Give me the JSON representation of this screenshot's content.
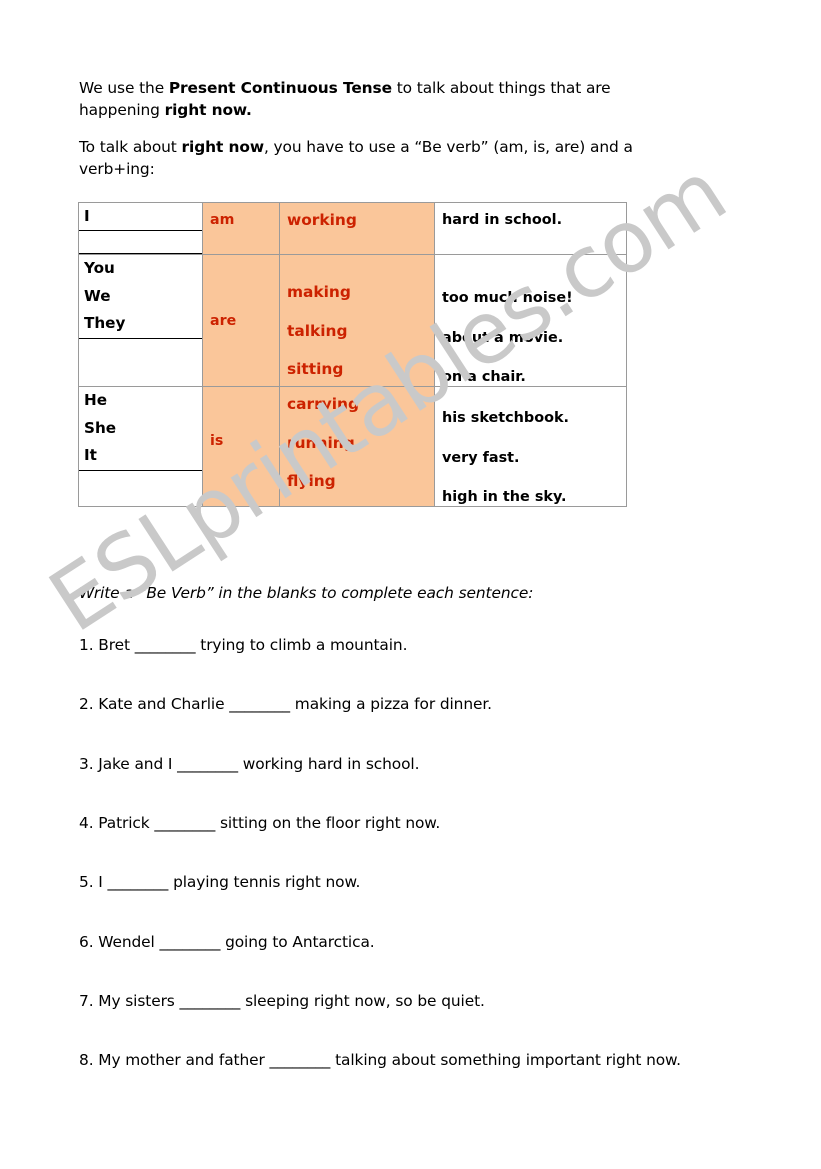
{
  "intro": {
    "paragraph1_pre": "We use the ",
    "paragraph1_bold1": "Present Continuous Tense",
    "paragraph1_mid": " to talk about things that are happening ",
    "paragraph1_bold2": "right now.",
    "paragraph2_pre": "To talk about ",
    "paragraph2_bold": "right now",
    "paragraph2_post": ", you have to use a “Be verb” (am, is, are) and a verb+ing:"
  },
  "table": {
    "groups": [
      {
        "subjects": [
          "I"
        ],
        "be": "am",
        "verbs": [
          "working"
        ],
        "rest": [
          "hard in school."
        ]
      },
      {
        "subjects": [
          "You",
          "We",
          "They"
        ],
        "be": "are",
        "verbs": [
          "making",
          "talking",
          "sitting"
        ],
        "rest": [
          "too much noise!",
          "about a movie.",
          "on a chair."
        ]
      },
      {
        "subjects": [
          "He",
          "She",
          "It"
        ],
        "be": "is",
        "verbs": [
          "carrying",
          "running",
          "flying"
        ],
        "rest": [
          "his sketchbook.",
          "very fast.",
          "high in the sky."
        ]
      }
    ]
  },
  "exercise": {
    "instruction": "Write a “Be Verb” in the blanks to complete each sentence:",
    "items": [
      "1. Bret ________ trying to climb a mountain.",
      "2. Kate and Charlie ________ making a pizza for dinner.",
      "3. Jake and I ________ working hard in school.",
      "4. Patrick ________ sitting on the floor right now.",
      "5. I ________ playing tennis right now.",
      "6. Wendel ________ going to Antarctica.",
      "7. My sisters ________ sleeping right now, so be quiet.",
      "8. My mother and father ________ talking about something important right now."
    ]
  },
  "watermark": {
    "text": "ESLprintables.com"
  },
  "colors": {
    "accent_red": "#cc2200",
    "cell_orange": "#fac69a",
    "border_gray": "#9a9a9a",
    "watermark_gray": "#c9c9c9"
  }
}
